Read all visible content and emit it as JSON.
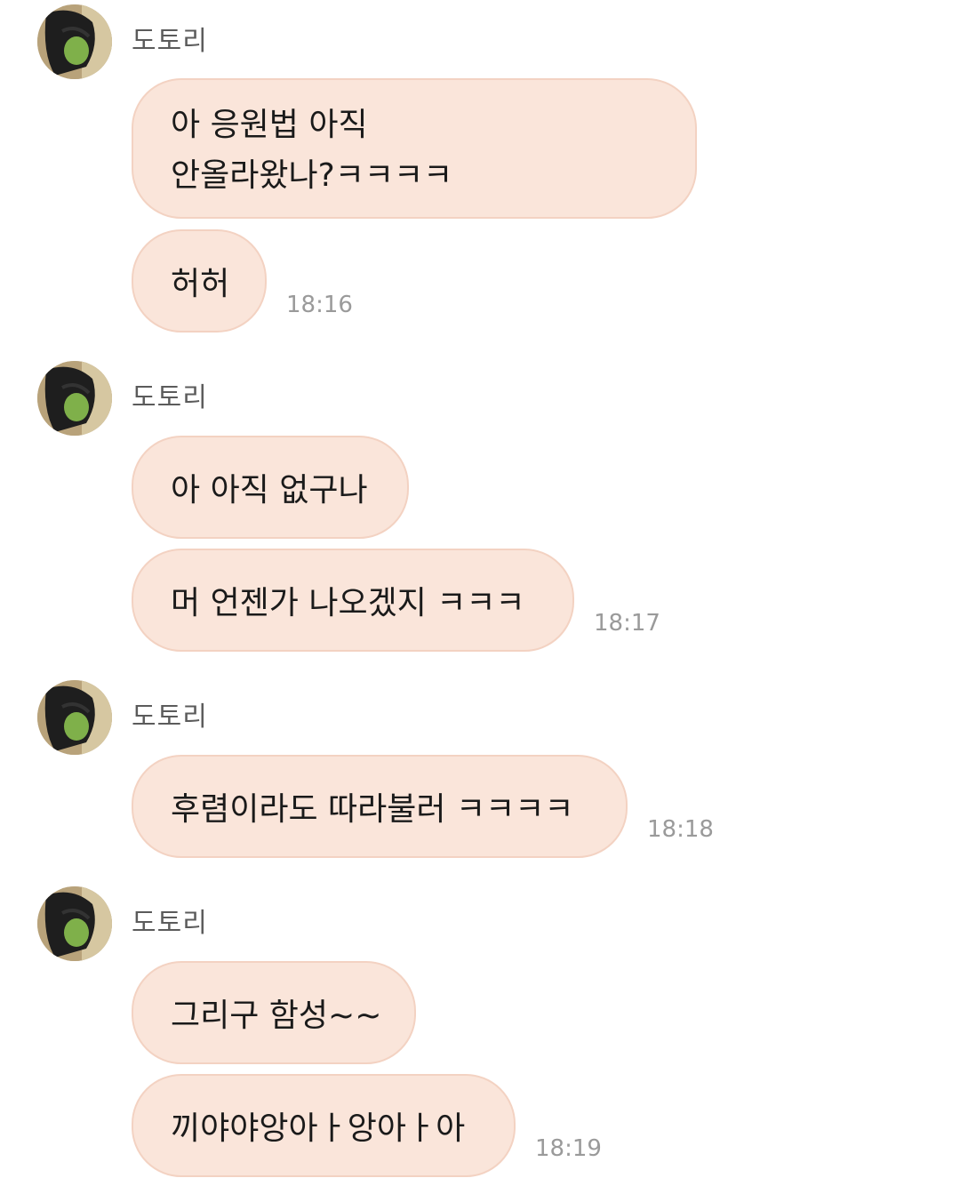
{
  "chat": {
    "sender_name": "도토리",
    "groups": [
      {
        "messages": [
          {
            "lines": [
              "아 응원법 아직",
              "안올라왔나?ㅋㅋㅋㅋ"
            ]
          },
          {
            "text": "허허"
          }
        ],
        "time": "18:16"
      },
      {
        "messages": [
          {
            "text": "아 아직 없구나"
          },
          {
            "text": "머 언젠가 나오겠지 ㅋㅋㅋ"
          }
        ],
        "time": "18:17"
      },
      {
        "messages": [
          {
            "text": "후렴이라도 따라불러 ㅋㅋㅋㅋ"
          }
        ],
        "time": "18:18"
      },
      {
        "messages": [
          {
            "text": "그리구 함성~~"
          },
          {
            "text": "끼야야앙아ㅏ앙아ㅏ아"
          }
        ],
        "time": "18:19"
      }
    ]
  }
}
